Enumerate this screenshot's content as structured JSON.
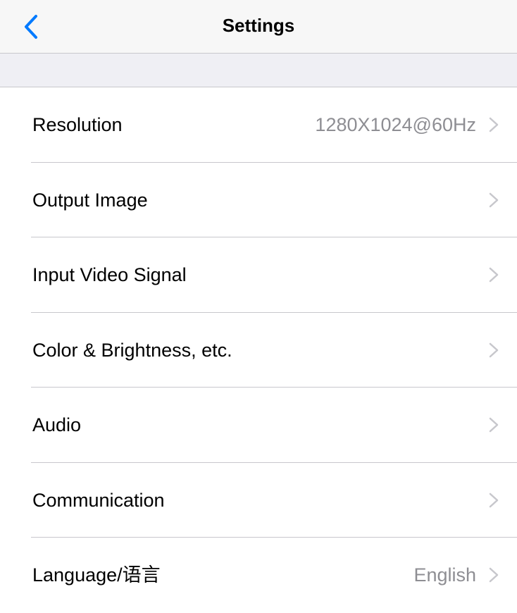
{
  "nav": {
    "title": "Settings",
    "back_icon": "chevron-left-icon"
  },
  "colors": {
    "accent": "#007aff",
    "nav_background": "#f7f7f7",
    "group_background": "#efeff4",
    "separator": "#c8c7cc",
    "secondary_text": "#8e8e93",
    "chevron": "#c7c7cc"
  },
  "settings": {
    "items": [
      {
        "label": "Resolution",
        "value": "1280X1024@60Hz"
      },
      {
        "label": "Output Image",
        "value": ""
      },
      {
        "label": "Input Video Signal",
        "value": ""
      },
      {
        "label": "Color & Brightness, etc.",
        "value": ""
      },
      {
        "label": "Audio",
        "value": ""
      },
      {
        "label": "Communication",
        "value": ""
      },
      {
        "label": "Language/语言",
        "value": "English"
      }
    ]
  }
}
